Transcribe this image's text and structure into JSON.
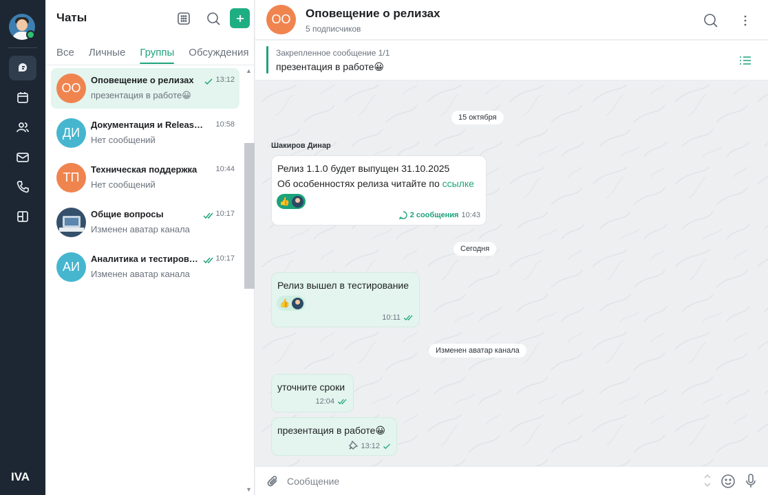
{
  "rail": {
    "logo": "IVA",
    "items": [
      {
        "icon": "chat-bubble-icon",
        "active": true
      },
      {
        "icon": "calendar-icon",
        "active": false
      },
      {
        "icon": "contacts-icon",
        "active": false
      },
      {
        "icon": "mail-icon",
        "active": false
      },
      {
        "icon": "phone-icon",
        "active": false
      },
      {
        "icon": "apps-grid-icon",
        "active": false
      }
    ]
  },
  "chat_list": {
    "title": "Чаты",
    "tabs": [
      {
        "label": "Все",
        "active": false
      },
      {
        "label": "Личные",
        "active": false
      },
      {
        "label": "Группы",
        "active": true
      },
      {
        "label": "Обсуждения",
        "active": false
      }
    ],
    "chats": [
      {
        "initials": "ОО",
        "color": "#f0844f",
        "name": "Оповещение о релизах",
        "preview": "презентация в работе😀",
        "time": "13:12",
        "check": "single",
        "selected": true
      },
      {
        "initials": "ДИ",
        "color": "#46b6cf",
        "name": "Документация и Release N…",
        "preview": "Нет сообщений",
        "time": "10:58",
        "check": "none",
        "selected": false
      },
      {
        "initials": "ТП",
        "color": "#f0844f",
        "name": "Техническая поддержка",
        "preview": "Нет сообщений",
        "time": "10:44",
        "check": "none",
        "selected": false
      },
      {
        "initials": "",
        "color": "#35506b",
        "name": "Общие вопросы",
        "preview": "Изменен аватар канала",
        "time": "10:17",
        "check": "double",
        "selected": false
      },
      {
        "initials": "АИ",
        "color": "#46b6cf",
        "name": "Аналитика и тестирован…",
        "preview": "Изменен аватар канала",
        "time": "10:17",
        "check": "double",
        "selected": false
      }
    ]
  },
  "chat": {
    "avatar_initials": "ОО",
    "title": "Оповещение о релизах",
    "subtitle": "5 подписчиков",
    "pinned_label": "Закрепленное сообщение 1/1",
    "pinned_text": "презентация в работе😀",
    "date_1": "15 октября",
    "sender_1": "Шакиров Динар",
    "msg_1_line_1": "Релиз 1.1.0 будет выпущен 31.10.2025",
    "msg_1_line_2_prefix": "Об особенностях релиза читайте по ",
    "msg_1_link": "ссылке",
    "msg_1_reaction": "👍",
    "msg_1_thread": "2 сообщения",
    "msg_1_time": "10:43",
    "date_2": "Сегодня",
    "msg_2_text": "Релиз вышел в тестирование",
    "msg_2_reaction": "👍",
    "msg_2_time": "10:11",
    "system_1": "Изменен аватар канала",
    "msg_3_text": "уточните сроки",
    "msg_3_time": "12:04",
    "msg_4_text": "презентация в работе😀",
    "msg_4_time": "13:12"
  },
  "composer": {
    "placeholder": "Сообщение"
  }
}
